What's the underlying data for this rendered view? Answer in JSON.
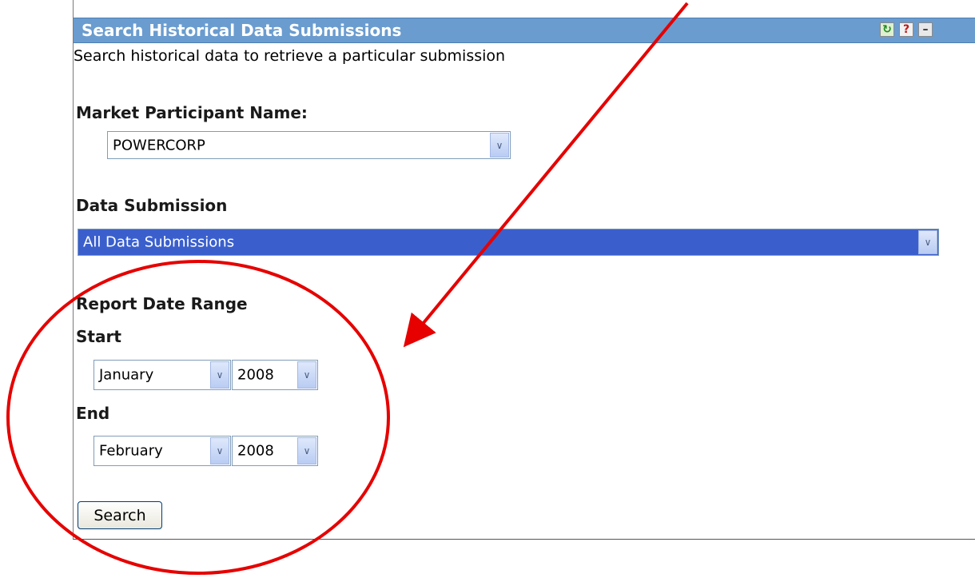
{
  "panel": {
    "title": "Search Historical Data Submissions",
    "buttons": {
      "refresh": "↻",
      "help": "?",
      "minimize": "–"
    },
    "description": "Search historical data to retrieve a particular submission"
  },
  "form": {
    "participant": {
      "label": "Market Participant Name:",
      "value": "POWERCORP"
    },
    "submission": {
      "label": "Data Submission",
      "value": "All Data Submissions"
    },
    "date_range": {
      "label": "Report Date Range",
      "start_label": "Start",
      "start_month": "January",
      "start_year": "2008",
      "end_label": "End",
      "end_month": "February",
      "end_year": "2008"
    },
    "search_label": "Search"
  },
  "dropdown_arrow": "∨",
  "annotation": {
    "color": "#e60000",
    "shapes": [
      "arrow",
      "ellipse"
    ]
  }
}
